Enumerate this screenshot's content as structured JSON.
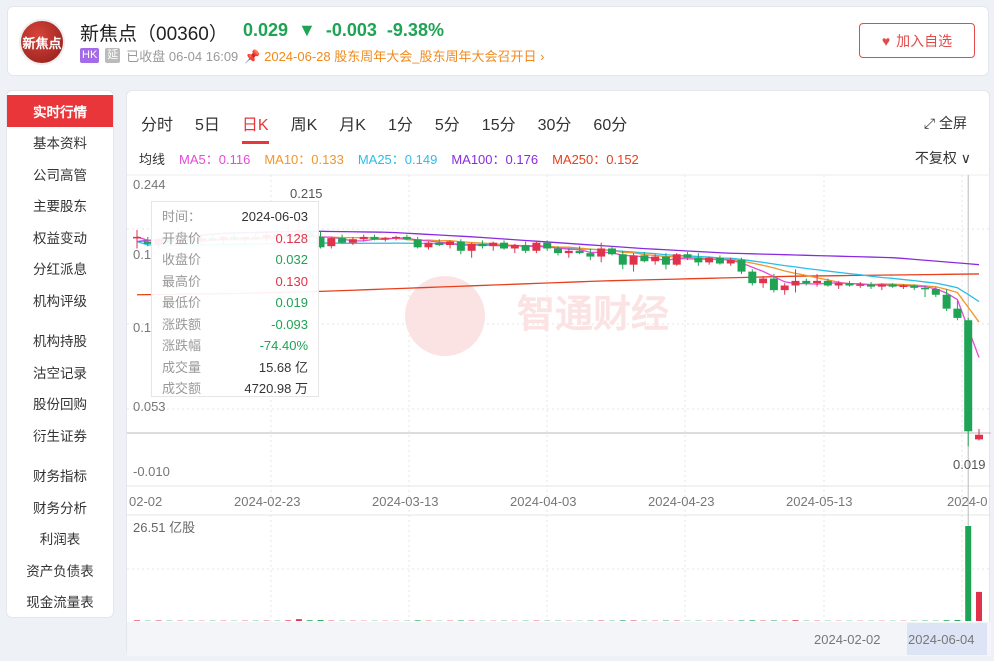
{
  "header": {
    "logo_text": "新焦点",
    "name": "新焦点（00360）",
    "last": "0.029",
    "change": "-0.003",
    "change_pct": "-9.38%",
    "market_tag": "HK",
    "delay_tag": "延",
    "status": "已收盘 06-04 16:09",
    "event": "2024-06-28 股东周年大会_股东周年大会召开日",
    "add_watch": "加入自选"
  },
  "sidebar": {
    "items": [
      "实时行情",
      "基本资料",
      "公司高管",
      "主要股东",
      "权益变动",
      "分红派息",
      "机构评级",
      "机构持股",
      "沽空记录",
      "股份回购",
      "衍生证券",
      "财务指标",
      "财务分析",
      "利润表",
      "资产负债表",
      "现金流量表"
    ]
  },
  "tabs": [
    "分时",
    "5日",
    "日K",
    "周K",
    "月K",
    "1分",
    "5分",
    "15分",
    "30分",
    "60分"
  ],
  "fullscreen": "全屏",
  "ma_legend": {
    "title": "均线",
    "ma5": "MA5：0.116",
    "ma10": "MA10：0.133",
    "ma25": "MA25：0.149",
    "ma100": "MA100：0.176",
    "ma250": "MA250：0.152"
  },
  "adjust": "不复权",
  "colors": {
    "up": "#e0324b",
    "down": "#1fa354",
    "ma5": "#e64ad8",
    "ma10": "#f0962a",
    "ma25": "#2cbde8",
    "ma100": "#8a2be2",
    "ma250": "#e8401c"
  },
  "tooltip": [
    {
      "k": "时间：",
      "v": "2024-06-03",
      "c": ""
    },
    {
      "k": "开盘价",
      "v": "0.128",
      "c": "up"
    },
    {
      "k": "收盘价",
      "v": "0.032",
      "c": "dn"
    },
    {
      "k": "最高价",
      "v": "0.130",
      "c": "up"
    },
    {
      "k": "最低价",
      "v": "0.019",
      "c": "dn"
    },
    {
      "k": "涨跌额",
      "v": "-0.093",
      "c": "dn"
    },
    {
      "k": "涨跌幅",
      "v": "-74.40%",
      "c": "dn"
    },
    {
      "k": "成交量",
      "v": "15.68 亿",
      "c": ""
    },
    {
      "k": "成交额",
      "v": "4720.98 万",
      "c": ""
    }
  ],
  "chart_data": {
    "type": "candlestick",
    "y_labels": [
      "0.244",
      "0.1",
      "0.1",
      "0.053",
      "-0.010"
    ],
    "max_label": "0.215",
    "min_label": "0.019",
    "x_labels": [
      "02-02",
      "2024-02-23",
      "2024-03-13",
      "2024-04-03",
      "2024-04-23",
      "2024-05-13",
      "2024-0"
    ],
    "volume_label": "26.51 亿股",
    "range": [
      "2024-02-02",
      "2024-06-04"
    ],
    "ma100": [
      0.196,
      0.203,
      0.205,
      0.204,
      0.2,
      0.195,
      0.19,
      0.186,
      0.184,
      0.182,
      0.176
    ],
    "ma250": [
      0.17,
      0.171,
      0.173,
      0.176,
      0.179,
      0.182,
      0.184,
      0.186,
      0.187,
      0.188,
      0.152
    ],
    "candles": [
      [
        0.2,
        0.206,
        0.19,
        0.2
      ],
      [
        0.196,
        0.2,
        0.192,
        0.194
      ],
      [
        0.194,
        0.2,
        0.19,
        0.198
      ],
      [
        0.198,
        0.201,
        0.194,
        0.195
      ],
      [
        0.195,
        0.2,
        0.192,
        0.198
      ],
      [
        0.198,
        0.202,
        0.195,
        0.196
      ],
      [
        0.196,
        0.2,
        0.193,
        0.199
      ],
      [
        0.199,
        0.203,
        0.196,
        0.197
      ],
      [
        0.197,
        0.201,
        0.194,
        0.2
      ],
      [
        0.2,
        0.203,
        0.197,
        0.198
      ],
      [
        0.198,
        0.201,
        0.195,
        0.2
      ],
      [
        0.2,
        0.204,
        0.197,
        0.199
      ],
      [
        0.199,
        0.205,
        0.196,
        0.202
      ],
      [
        0.202,
        0.206,
        0.198,
        0.2
      ],
      [
        0.2,
        0.21,
        0.198,
        0.203
      ],
      [
        0.203,
        0.215,
        0.2,
        0.206
      ],
      [
        0.205,
        0.208,
        0.196,
        0.2
      ],
      [
        0.2,
        0.205,
        0.19,
        0.191
      ],
      [
        0.192,
        0.2,
        0.19,
        0.199
      ],
      [
        0.199,
        0.202,
        0.194,
        0.195
      ],
      [
        0.195,
        0.2,
        0.193,
        0.198
      ],
      [
        0.198,
        0.202,
        0.196,
        0.2
      ],
      [
        0.2,
        0.202,
        0.197,
        0.198
      ],
      [
        0.198,
        0.2,
        0.196,
        0.199
      ],
      [
        0.199,
        0.201,
        0.197,
        0.2
      ],
      [
        0.2,
        0.202,
        0.197,
        0.198
      ],
      [
        0.198,
        0.2,
        0.19,
        0.191
      ],
      [
        0.191,
        0.196,
        0.189,
        0.195
      ],
      [
        0.195,
        0.198,
        0.192,
        0.193
      ],
      [
        0.193,
        0.197,
        0.19,
        0.196
      ],
      [
        0.196,
        0.198,
        0.185,
        0.188
      ],
      [
        0.188,
        0.195,
        0.182,
        0.194
      ],
      [
        0.194,
        0.197,
        0.19,
        0.192
      ],
      [
        0.192,
        0.196,
        0.188,
        0.195
      ],
      [
        0.195,
        0.197,
        0.189,
        0.19
      ],
      [
        0.19,
        0.194,
        0.186,
        0.193
      ],
      [
        0.193,
        0.196,
        0.186,
        0.188
      ],
      [
        0.188,
        0.196,
        0.186,
        0.195
      ],
      [
        0.195,
        0.197,
        0.188,
        0.19
      ],
      [
        0.19,
        0.192,
        0.184,
        0.186
      ],
      [
        0.186,
        0.19,
        0.182,
        0.188
      ],
      [
        0.188,
        0.192,
        0.185,
        0.186
      ],
      [
        0.186,
        0.19,
        0.18,
        0.183
      ],
      [
        0.183,
        0.195,
        0.178,
        0.19
      ],
      [
        0.19,
        0.192,
        0.184,
        0.185
      ],
      [
        0.185,
        0.188,
        0.172,
        0.176
      ],
      [
        0.176,
        0.186,
        0.17,
        0.184
      ],
      [
        0.184,
        0.187,
        0.178,
        0.179
      ],
      [
        0.179,
        0.185,
        0.176,
        0.183
      ],
      [
        0.183,
        0.186,
        0.172,
        0.176
      ],
      [
        0.176,
        0.186,
        0.175,
        0.185
      ],
      [
        0.185,
        0.187,
        0.18,
        0.182
      ],
      [
        0.182,
        0.186,
        0.175,
        0.178
      ],
      [
        0.178,
        0.183,
        0.176,
        0.182
      ],
      [
        0.182,
        0.184,
        0.176,
        0.177
      ],
      [
        0.177,
        0.182,
        0.175,
        0.18
      ],
      [
        0.18,
        0.182,
        0.168,
        0.17
      ],
      [
        0.17,
        0.172,
        0.158,
        0.16
      ],
      [
        0.16,
        0.166,
        0.156,
        0.164
      ],
      [
        0.164,
        0.168,
        0.152,
        0.154
      ],
      [
        0.154,
        0.16,
        0.15,
        0.158
      ],
      [
        0.158,
        0.172,
        0.152,
        0.162
      ],
      [
        0.162,
        0.164,
        0.158,
        0.16
      ],
      [
        0.16,
        0.168,
        0.157,
        0.162
      ],
      [
        0.162,
        0.164,
        0.157,
        0.158
      ],
      [
        0.158,
        0.162,
        0.155,
        0.16
      ],
      [
        0.16,
        0.162,
        0.157,
        0.158
      ],
      [
        0.158,
        0.161,
        0.156,
        0.159
      ],
      [
        0.159,
        0.161,
        0.155,
        0.157
      ],
      [
        0.157,
        0.16,
        0.154,
        0.159
      ],
      [
        0.159,
        0.16,
        0.156,
        0.157
      ],
      [
        0.157,
        0.159,
        0.155,
        0.158
      ],
      [
        0.158,
        0.159,
        0.154,
        0.156
      ],
      [
        0.156,
        0.158,
        0.148,
        0.155
      ],
      [
        0.155,
        0.157,
        0.148,
        0.15
      ],
      [
        0.15,
        0.155,
        0.136,
        0.138
      ],
      [
        0.138,
        0.145,
        0.128,
        0.13
      ],
      [
        0.128,
        0.13,
        0.019,
        0.032
      ],
      [
        0.025,
        0.034,
        0.024,
        0.029
      ]
    ],
    "volumes": [
      0.1,
      0.05,
      0.08,
      0.05,
      0.05,
      0.05,
      0.04,
      0.05,
      0.05,
      0.04,
      0.05,
      0.05,
      0.06,
      0.05,
      0.1,
      0.3,
      0.12,
      0.15,
      0.06,
      0.05,
      0.05,
      0.04,
      0.04,
      0.04,
      0.04,
      0.04,
      0.1,
      0.05,
      0.04,
      0.05,
      0.08,
      0.06,
      0.04,
      0.04,
      0.05,
      0.04,
      0.05,
      0.06,
      0.05,
      0.05,
      0.04,
      0.04,
      0.06,
      0.07,
      0.05,
      0.1,
      0.08,
      0.05,
      0.05,
      0.07,
      0.06,
      0.04,
      0.05,
      0.04,
      0.04,
      0.05,
      0.08,
      0.1,
      0.06,
      0.08,
      0.06,
      0.12,
      0.05,
      0.05,
      0.04,
      0.04,
      0.04,
      0.04,
      0.04,
      0.04,
      0.04,
      0.04,
      0.04,
      0.06,
      0.05,
      0.12,
      0.15,
      15.68,
      4.8
    ]
  }
}
